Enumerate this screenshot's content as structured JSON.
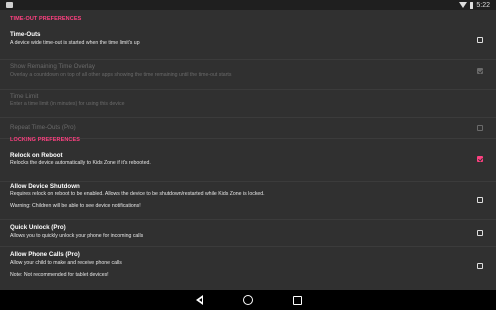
{
  "status_bar": {
    "time": "5:22",
    "icons": [
      "notification-icon",
      "wifi-icon",
      "battery-icon"
    ]
  },
  "sections": {
    "timeout_header": "TIME-OUT PREFERENCES",
    "locking_header": "LOCKING PREFERENCES"
  },
  "prefs": {
    "timeouts": {
      "title": "Time-Outs",
      "summary": "A device wide time-out is started when the time limit's up",
      "checked": false
    },
    "overlay": {
      "title": "Show Remaining Time Overlay",
      "summary": "Overlay a countdown on top of all other apps showing the time remaining until the time-out starts",
      "checked": true,
      "enabled": false
    },
    "time_limit": {
      "title": "Time Limit",
      "summary": "Enter a time limit (in minutes) for using this device",
      "enabled": false
    },
    "repeat": {
      "title": "Repeat Time-Outs (Pro)",
      "checked": false,
      "enabled": false
    },
    "relock": {
      "title": "Relock on Reboot",
      "summary": "Relocks the device automatically to Kids Zone if it's rebooted.",
      "checked": true
    },
    "allow_shutdown": {
      "title": "Allow Device Shutdown",
      "summary": "Requires relock on reboot to be enabled. Allows the device to be shutdown/restarted while Kids Zone is locked.",
      "note": "Warning: Children will be able to see device notifications!",
      "checked": false
    },
    "quick_unlock": {
      "title": "Quick Unlock (Pro)",
      "summary": "Allows you to quickly unlock your phone for incoming calls",
      "checked": false
    },
    "phone_calls": {
      "title": "Allow Phone Calls (Pro)",
      "summary": "Allow your child to make and receive phone calls",
      "note": "Note: Not recommended for tablet devices!",
      "checked": false
    }
  },
  "colors": {
    "accent": "#ff4081",
    "background": "#303030",
    "navbar": "#000000"
  }
}
